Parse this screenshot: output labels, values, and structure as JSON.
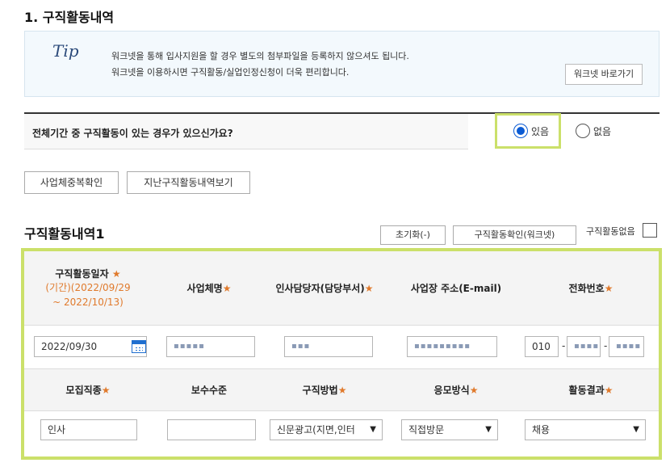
{
  "section_title": "1. 구직활동내역",
  "tip": {
    "icon_text": "Tip",
    "line1": "워크넷을 통해 입사지원을 할 경우 별도의 첨부파일을 등록하지 않으셔도 됩니다.",
    "line2": "워크넷을 이용하시면 구직활동/실업인정신청이 더욱 편리합니다.",
    "button": "워크넷 바로가기"
  },
  "question": {
    "text": "전체기간 중 구직활동이 있는 경우가 있으신가요?",
    "options": [
      {
        "label": "있음",
        "selected": true
      },
      {
        "label": "없음",
        "selected": false
      }
    ]
  },
  "buttons": {
    "dup_check": "사업체중복확인",
    "past_history": "지난구직활동내역보기"
  },
  "activity": {
    "title": "구직활동내역1",
    "reset": "초기화(-)",
    "confirm_worknet": "구직활동확인(워크넷)",
    "none_label": "구직활동없음",
    "none_checked": false,
    "headers_row1": {
      "date": "구직활동일자",
      "period": "(기간)(2022/09/29",
      "period2": "~ 2022/10/13)",
      "company": "사업체명",
      "manager": "인사담당자(담당부서)",
      "address": "사업장 주소(E-mail)",
      "phone": "전화번호"
    },
    "headers_row2": {
      "job": "모집직종",
      "pay": "보수수준",
      "method": "구직방법",
      "apply": "응모방식",
      "result": "활동결과"
    },
    "values": {
      "date": "2022/09/30",
      "company": "▪▪▪▪▪",
      "manager": "▪▪▪",
      "address": "▪▪▪▪▪▪▪▪▪",
      "phone1": "010",
      "phone2": "▪▪▪▪",
      "phone3": "▪▪▪▪",
      "job": "인사",
      "pay": "",
      "method": "신문광고(지면,인터",
      "apply": "직접방문",
      "result": "채용"
    },
    "required_mark": "★",
    "dash": "-"
  },
  "colors": {
    "highlight": "#cbe06a",
    "required": "#e07a2c",
    "radio": "#0b5bd3"
  }
}
